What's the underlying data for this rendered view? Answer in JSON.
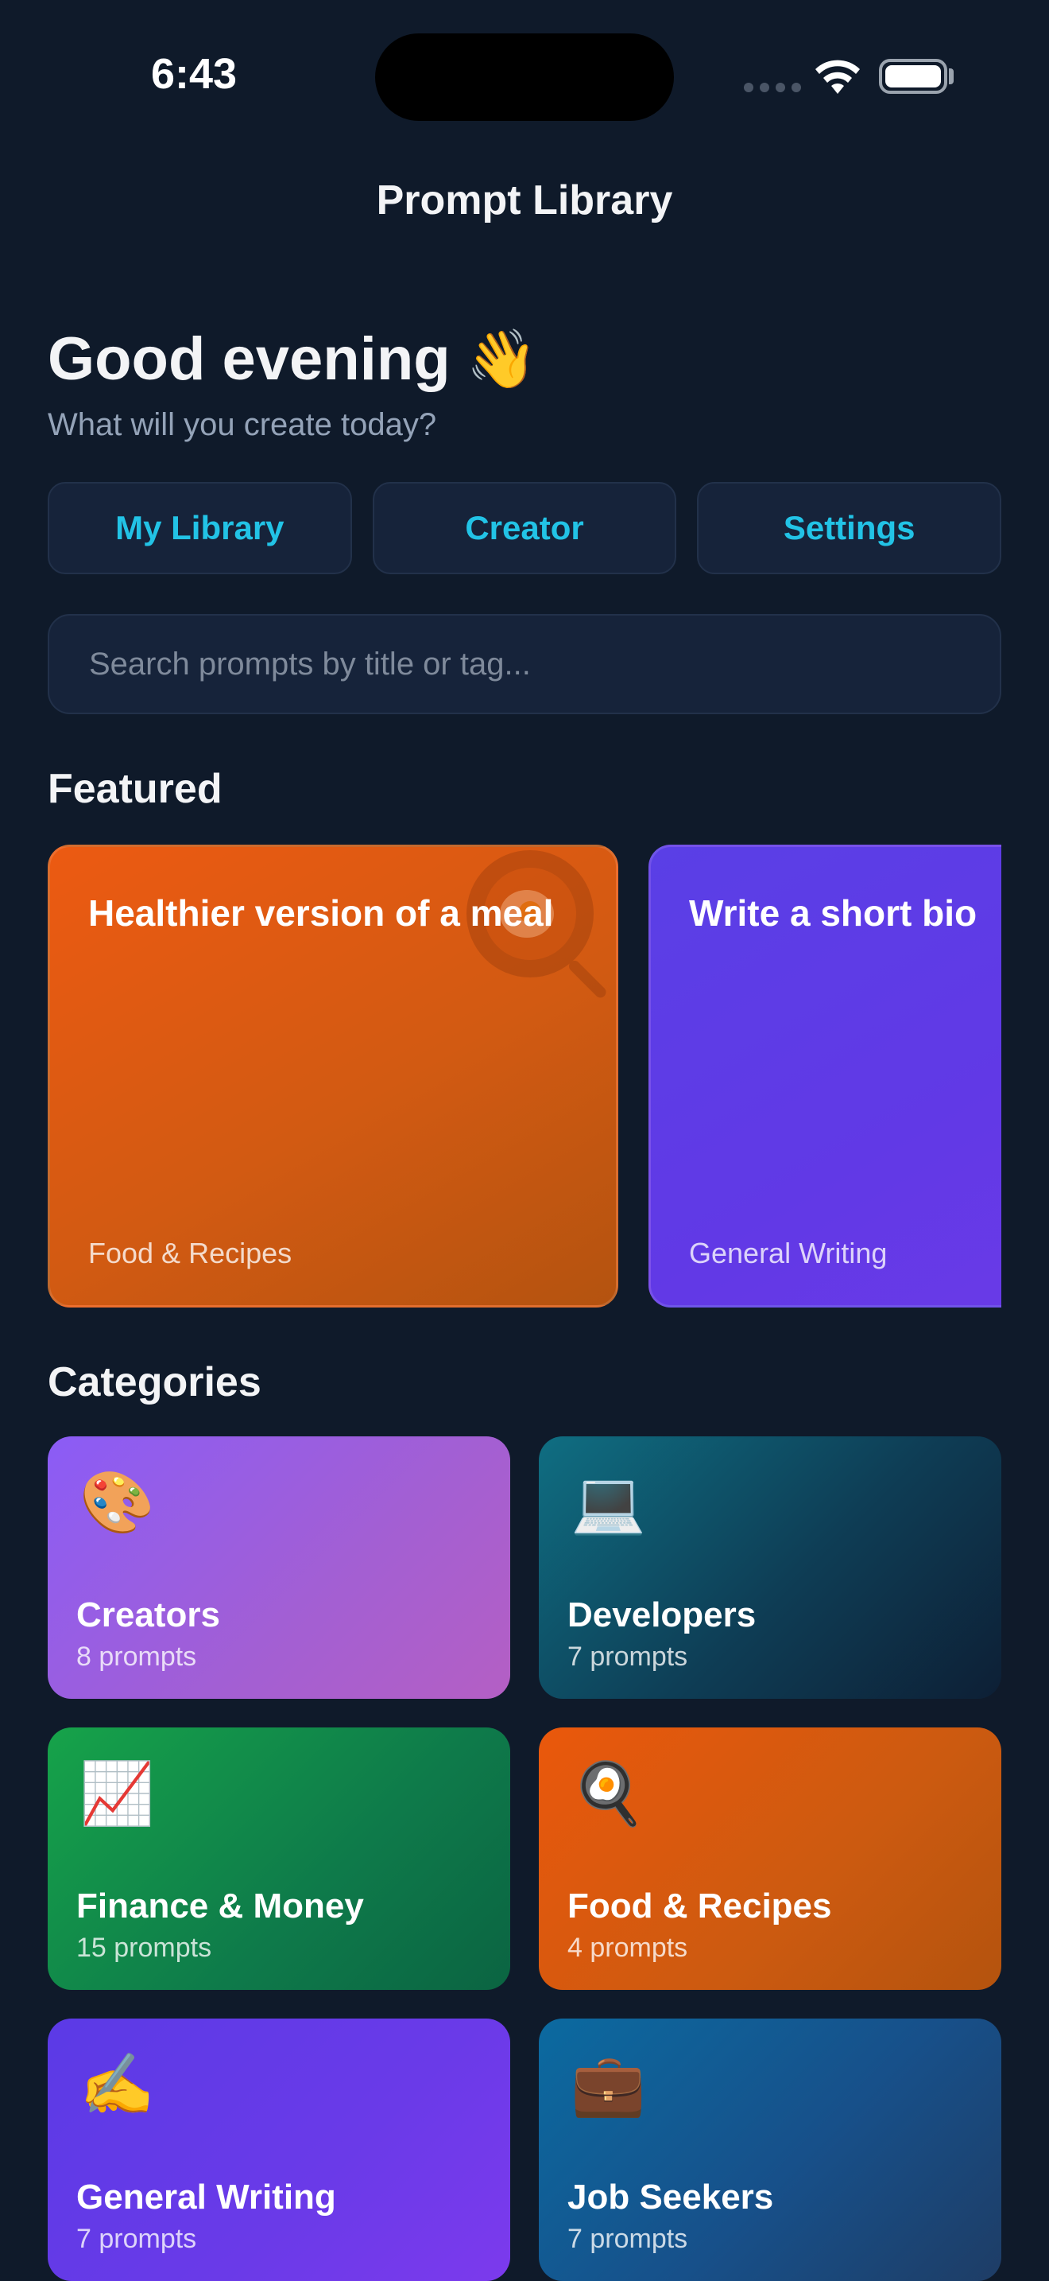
{
  "status_bar": {
    "time": "6:43"
  },
  "nav": {
    "title": "Prompt Library"
  },
  "greeting": {
    "title": "Good evening",
    "emoji": "👋",
    "subtitle": "What will you create today?"
  },
  "top_buttons": [
    {
      "label": "My Library"
    },
    {
      "label": "Creator"
    },
    {
      "label": "Settings"
    }
  ],
  "search": {
    "placeholder": "Search prompts by title or tag...",
    "value": ""
  },
  "featured": {
    "title": "Featured",
    "cards": [
      {
        "title": "Healthier version of a meal",
        "category": "Food & Recipes",
        "color": "#e2580f"
      },
      {
        "title": "Write a short bio",
        "category": "General Writing",
        "color": "#5e3be6"
      }
    ]
  },
  "categories": {
    "title": "Categories",
    "items": [
      {
        "icon": "🎨",
        "icon_name": "palette-icon",
        "name": "Creators",
        "count": "8 prompts"
      },
      {
        "icon": "💻",
        "icon_name": "laptop-icon",
        "name": "Developers",
        "count": "7 prompts"
      },
      {
        "icon": "📈",
        "icon_name": "chart-up-icon",
        "name": "Finance & Money",
        "count": "15 prompts"
      },
      {
        "icon": "🍳",
        "icon_name": "frying-pan-icon",
        "name": "Food & Recipes",
        "count": "4 prompts"
      },
      {
        "icon": "✍️",
        "icon_name": "writing-hand-icon",
        "name": "General Writing",
        "count": "7 prompts"
      },
      {
        "icon": "💼",
        "icon_name": "briefcase-icon",
        "name": "Job Seekers",
        "count": "7 prompts"
      }
    ]
  },
  "colors": {
    "background": "#0f1a2a",
    "accent": "#22c3e6",
    "surface": "#16233a"
  }
}
